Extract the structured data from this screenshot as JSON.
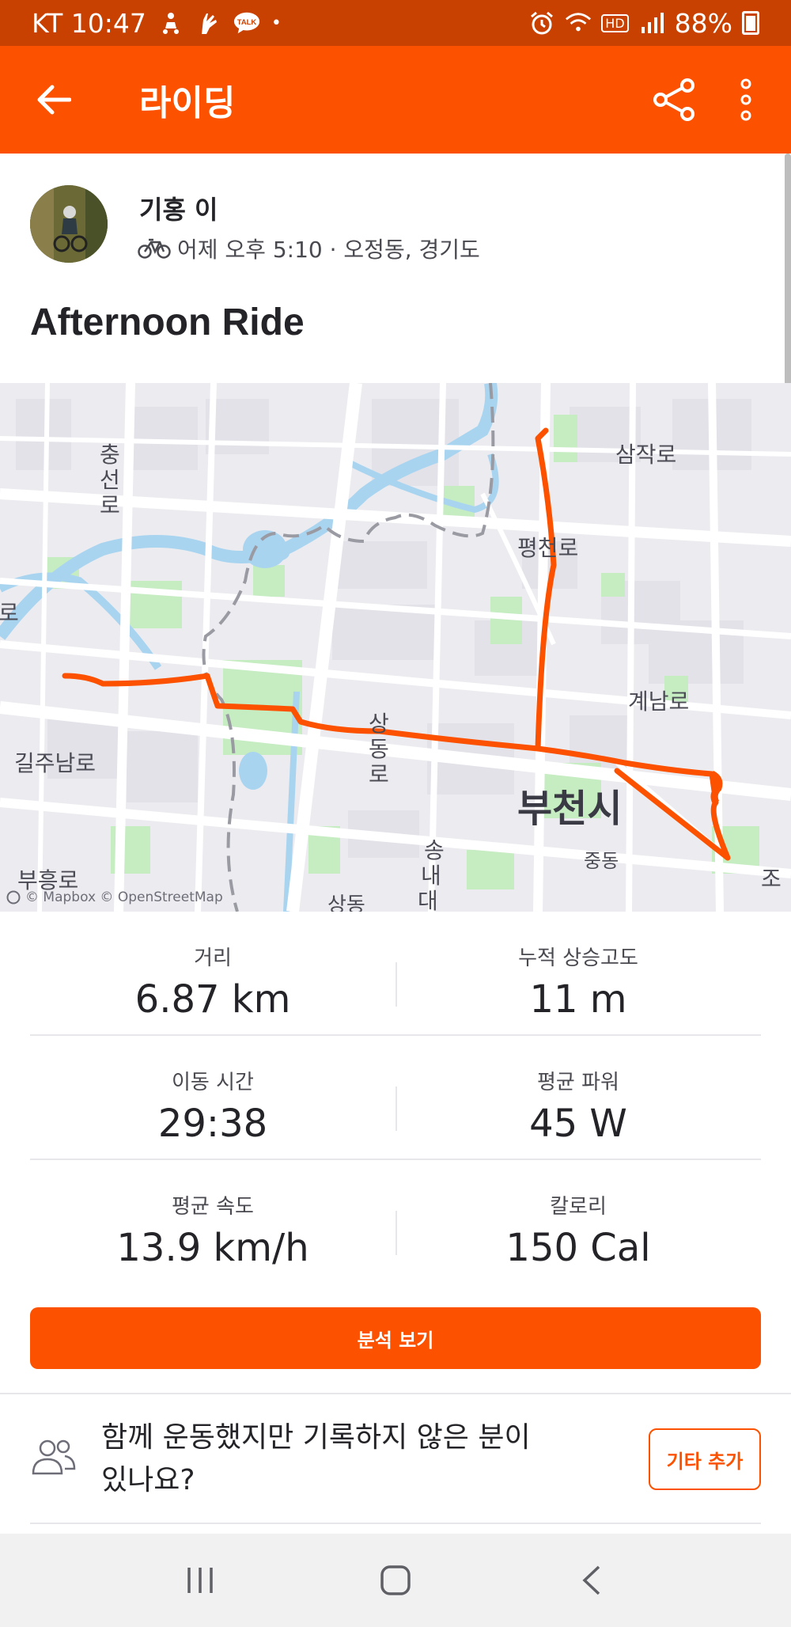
{
  "status_bar": {
    "carrier_time": "KT 10:47",
    "notifications": [
      "cycling-person-icon",
      "hand-icon",
      "talk-chat-icon",
      "dot"
    ],
    "talk_badge": "TALK",
    "hd_badge": "HD",
    "battery": "88%"
  },
  "app_bar": {
    "title": "라이딩",
    "back_icon": "arrow-left-icon",
    "share_icon": "share-icon",
    "more_icon": "more-vertical-icon"
  },
  "athlete": {
    "name": "기홍 이",
    "activity_icon": "bike-icon",
    "meta": "어제 오후 5:10 · 오정동, 경기도"
  },
  "activity": {
    "title": "Afternoon Ride"
  },
  "map": {
    "labels": {
      "sapjak_ro": "삼작로",
      "pyeongcheon_ro": "평천로",
      "gyenam_ro": "계남로",
      "bucheon_si": "부천시",
      "jung_dong": "중동",
      "gilju_nam_ro": "길주남로",
      "buheung_ro": "부흥로",
      "jo_partial": "조",
      "ro_partial": "로",
      "chungseon_ro": [
        "충",
        "선",
        "로"
      ],
      "sangdong_ro": [
        "상",
        "동",
        "로"
      ],
      "songnae_dae": [
        "송",
        "내",
        "대"
      ],
      "sang_partial": "상동"
    },
    "attribution": "© Mapbox © OpenStreetMap",
    "route_color": "#fc5200"
  },
  "stats": [
    {
      "left": {
        "label": "거리",
        "value": "6.87 km"
      },
      "right": {
        "label": "누적 상승고도",
        "value": "11 m"
      }
    },
    {
      "left": {
        "label": "이동 시간",
        "value": "29:38"
      },
      "right": {
        "label": "평균 파워",
        "value": "45 W"
      }
    },
    {
      "left": {
        "label": "평균 속도",
        "value": "13.9 km/h"
      },
      "right": {
        "label": "칼로리",
        "value": "150 Cal"
      }
    }
  ],
  "actions": {
    "analysis_label": "분석 보기",
    "prompt_line1": "함께 운동했지만 기록하지 않은 분이",
    "prompt_line2": "있나요?",
    "add_others_label": "기타 추가"
  },
  "colors": {
    "brand": "#fc5200",
    "status_bar": "#c94100"
  }
}
